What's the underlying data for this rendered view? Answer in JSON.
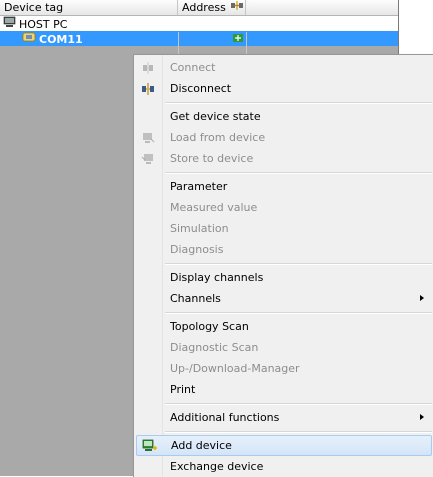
{
  "tree": {
    "columns": [
      "Device tag",
      "Address"
    ],
    "rows": [
      {
        "label": "HOST PC",
        "icon": "host-pc-icon"
      },
      {
        "label": "COM11",
        "icon": "com-port-icon",
        "selected": true
      }
    ]
  },
  "menu": {
    "items": [
      {
        "label": "Connect",
        "enabled": false,
        "icon": "connect-icon"
      },
      {
        "label": "Disconnect",
        "enabled": true,
        "icon": "disconnect-icon"
      },
      {
        "label": "Get device state",
        "enabled": true
      },
      {
        "label": "Load from device",
        "enabled": false,
        "icon": "load-from-device-icon"
      },
      {
        "label": "Store to device",
        "enabled": false,
        "icon": "store-to-device-icon"
      },
      {
        "label": "Parameter",
        "enabled": true
      },
      {
        "label": "Measured value",
        "enabled": false
      },
      {
        "label": "Simulation",
        "enabled": false
      },
      {
        "label": "Diagnosis",
        "enabled": false
      },
      {
        "label": "Display channels",
        "enabled": true
      },
      {
        "label": "Channels",
        "enabled": true,
        "submenu": true
      },
      {
        "label": "Topology Scan",
        "enabled": true
      },
      {
        "label": "Diagnostic Scan",
        "enabled": false
      },
      {
        "label": "Up-/Download-Manager",
        "enabled": false
      },
      {
        "label": "Print",
        "enabled": true
      },
      {
        "label": "Additional functions",
        "enabled": true,
        "submenu": true
      },
      {
        "label": "Add device",
        "enabled": true,
        "highlighted": true,
        "icon": "add-device-icon"
      },
      {
        "label": "Exchange device",
        "enabled": true
      }
    ]
  },
  "colors": {
    "selection": "#3399ff",
    "tree_background": "#a9a9a9",
    "menu_background": "#f0f0f0",
    "disabled_text": "#8d8d8d"
  }
}
